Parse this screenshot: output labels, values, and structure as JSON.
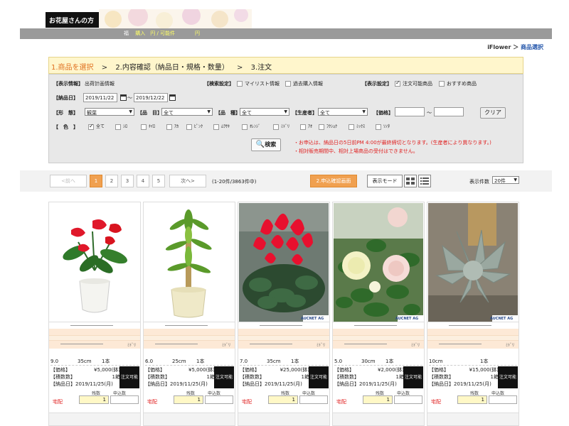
{
  "header": {
    "logo": "お花屋さんの方",
    "price_line_a": "福　",
    "price_line_b": "購入　円 / 可能件　　　　円"
  },
  "breadcrumb": {
    "home": "iFlower",
    "sep": "＞",
    "current": "商品選択"
  },
  "steps": {
    "step1": "1.商品を選択",
    "step2": "2.内容確認（納品日・規格・数量）",
    "step3": "3.注文",
    "sep": ">"
  },
  "search": {
    "display_info_label": "【表示情報】",
    "display_info_value": "出荷計画情報",
    "search_settings_label": "【検索設定】",
    "mylist": "マイリスト情報",
    "past_purchase": "過去購入情報",
    "display_settings_label": "【表示設定】",
    "orderable_only": "注文可能商品",
    "recommended": "おすすめ商品",
    "delivery_date_label": "【納品日】",
    "date_from": "2019/11/22",
    "date_tilde": "～",
    "date_to": "2019/12/22",
    "form_label": "【形　態】",
    "form_value": "観葉",
    "item_label": "【品　目】",
    "item_value": "全て",
    "variety_label": "【品　種】",
    "variety_value": "全て",
    "producer_label": "【生産者】",
    "producer_value": "全て",
    "price_label": "【価格】",
    "price_tilde": "～",
    "clear_button": "クリア",
    "color_label": "【　色　】",
    "colors": [
      "全て",
      "ｼﾛ",
      "ｷｲﾛ",
      "ｱｶ",
      "ﾋﾟﾝｸ",
      "ﾑﾗｻｷ",
      "ｵﾚﾝｼﾞ",
      "ﾐﾄﾞﾘ",
      "ｱｵ",
      "ﾌｸｼｮｸ",
      "ﾐｯｸｽ",
      "ｿﾉﾀ"
    ],
    "search_button": "検索",
    "notice_1": "・お申込は、納品日の5日前PM 4:00が最終締切となります。(生産者により異なります。)",
    "notice_2": "・相対販売期間中、相対上場商品の受付はできません。"
  },
  "pagination": {
    "prev": "<前へ",
    "pages": [
      "1",
      "2",
      "3",
      "4",
      "5"
    ],
    "next": "次へ>",
    "count": "(1-20件/3863件中)",
    "confirm_button": "2.申込確認画面",
    "display_mode": "表示モード",
    "per_page_label": "表示件数",
    "per_page_value": "20件"
  },
  "card_labels": {
    "price": "【価格】",
    "lot": "【積数数】",
    "delivery_date": "【納品日】",
    "badge": "注文可能",
    "delivery": "宅配",
    "qty_label_1": "残数",
    "qty_label_2": "申込数",
    "color": "ﾐﾄﾞﾘ"
  },
  "products": [
    {
      "grade": "9.0",
      "size": "35cm",
      "count": "1本",
      "price": "¥5,000(鉢)",
      "lot": "1箱",
      "date": "2019/11/25(月)",
      "qty": "1"
    },
    {
      "grade": "6.0",
      "size": "25cm",
      "count": "1本",
      "price": "¥5,000(鉢)",
      "lot": "1箱",
      "date": "2019/11/25(月)",
      "qty": "1"
    },
    {
      "grade": "7.0",
      "size": "35cm",
      "count": "1本",
      "price": "¥25,000(鉢)",
      "lot": "1箱",
      "date": "2019/11/25(月)",
      "qty": "1"
    },
    {
      "grade": "5.0",
      "size": "30cm",
      "count": "1本",
      "price": "¥2,000(鉢)",
      "lot": "1箱",
      "date": "2019/11/25(月)",
      "qty": "1"
    },
    {
      "grade": "10cm",
      "size": "",
      "count": "1本",
      "price": "¥15,000(鉢)",
      "lot": "1箱",
      "date": "2019/11/25(月)",
      "qty": "1"
    }
  ],
  "watermark": "AUCNET AG",
  "colors": {
    "accent": "#e07020",
    "step_bg": "#fff6cc",
    "notice": "#e02020",
    "active_page": "#f0a050"
  }
}
